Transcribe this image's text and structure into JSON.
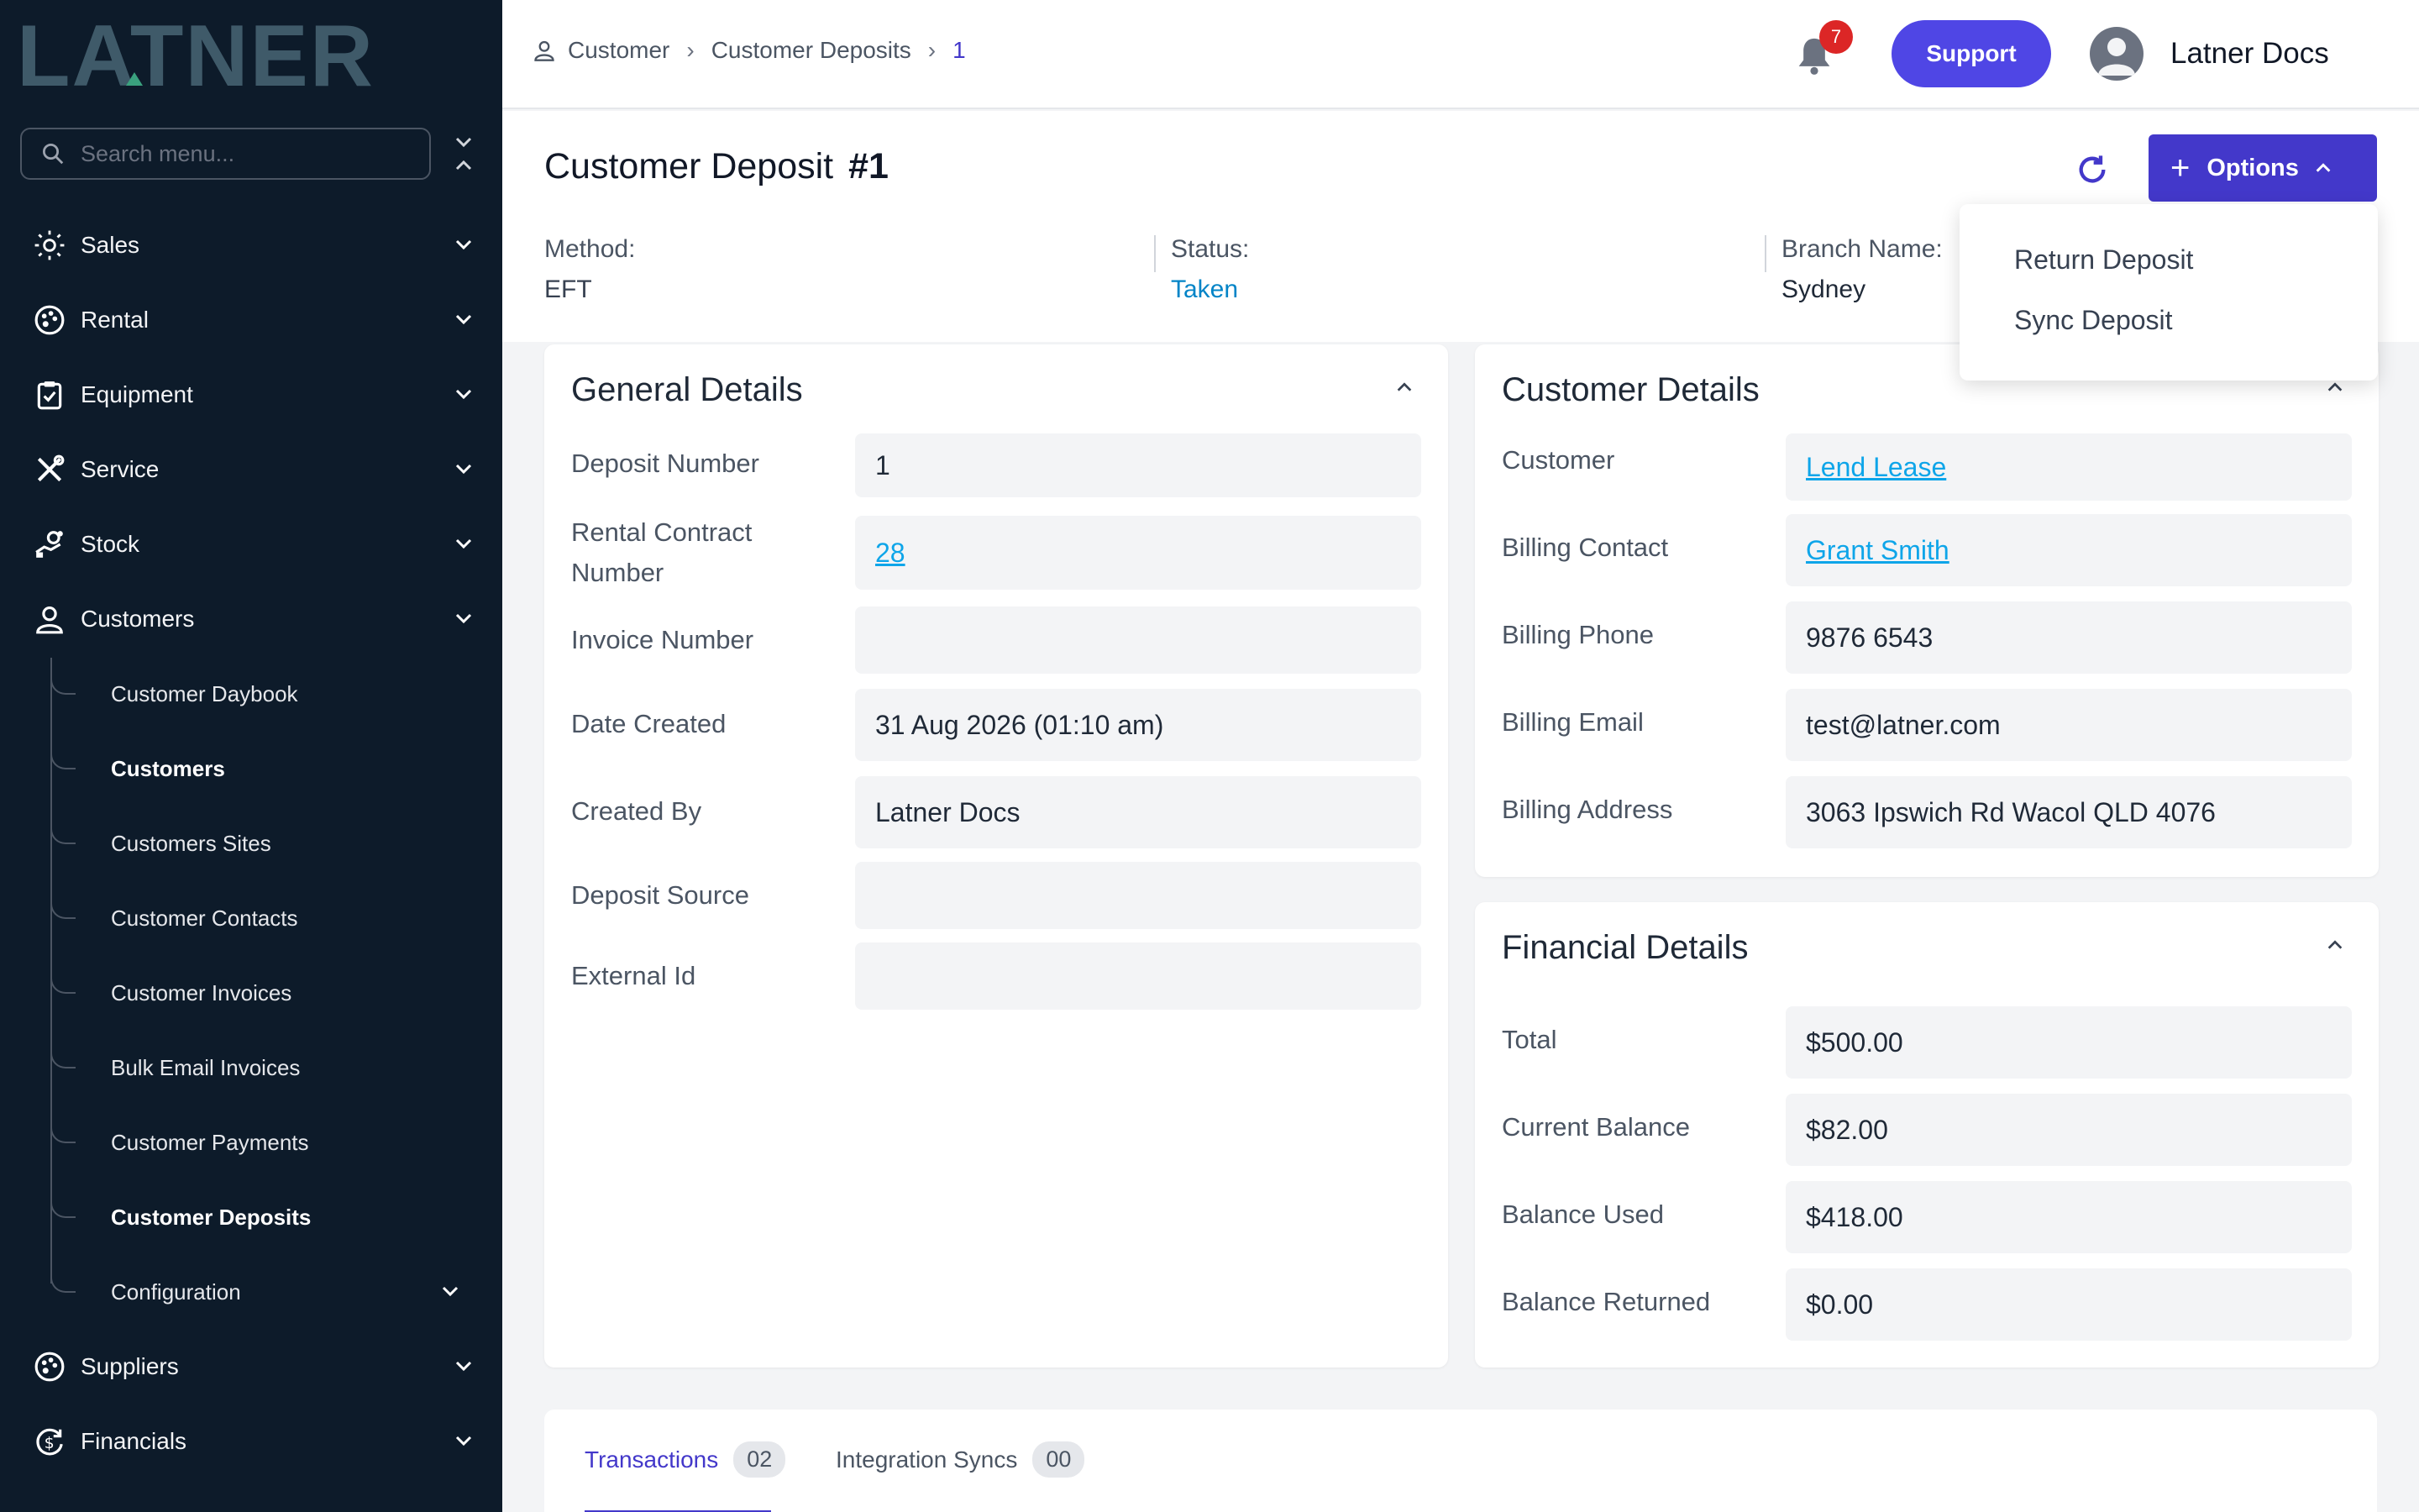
{
  "brand": {
    "logo_text": "LATNER"
  },
  "sidebar": {
    "search_placeholder": "Search menu...",
    "items": [
      {
        "label": "Sales",
        "icon": "sun-icon"
      },
      {
        "label": "Rental",
        "icon": "palette-icon"
      },
      {
        "label": "Equipment",
        "icon": "clipboard-icon"
      },
      {
        "label": "Service",
        "icon": "tools-icon"
      },
      {
        "label": "Stock",
        "icon": "hand-coins-icon"
      },
      {
        "label": "Customers",
        "icon": "user-icon"
      }
    ],
    "sub_items": [
      {
        "label": "Customer Daybook"
      },
      {
        "label": "Customers"
      },
      {
        "label": "Customers Sites"
      },
      {
        "label": "Customer Contacts"
      },
      {
        "label": "Customer Invoices"
      },
      {
        "label": "Bulk Email Invoices"
      },
      {
        "label": "Customer Payments"
      },
      {
        "label": "Customer Deposits"
      },
      {
        "label": "Configuration"
      }
    ],
    "bottom_items": [
      {
        "label": "Suppliers",
        "icon": "palette-icon"
      },
      {
        "label": "Financials",
        "icon": "dollar-cycle-icon"
      }
    ]
  },
  "header": {
    "breadcrumb": [
      "Customer",
      "Customer Deposits",
      "1"
    ],
    "notification_count": "7",
    "support_label": "Support",
    "user_name": "Latner Docs"
  },
  "page": {
    "title": "Customer Deposit",
    "number": "#1",
    "options_label": "Options",
    "meta": [
      {
        "label": "Method:",
        "value": "EFT"
      },
      {
        "label": "Status:",
        "value": "Taken"
      },
      {
        "label": "Branch Name:",
        "value": "Sydney"
      }
    ],
    "options_menu": [
      "Return Deposit",
      "Sync Deposit"
    ]
  },
  "general_details": {
    "title": "General Details",
    "rows": [
      {
        "label": "Deposit Number",
        "value": "1"
      },
      {
        "label": "Rental Contract Number",
        "value": "28"
      },
      {
        "label": "Invoice Number",
        "value": ""
      },
      {
        "label": "Date Created",
        "value": "31 Aug 2026 (01:10 am)"
      },
      {
        "label": "Created By",
        "value": "Latner Docs"
      },
      {
        "label": "Deposit Source",
        "value": ""
      },
      {
        "label": "External Id",
        "value": ""
      }
    ]
  },
  "customer_details": {
    "title": "Customer Details",
    "rows": [
      {
        "label": "Customer",
        "value": "Lend Lease"
      },
      {
        "label": "Billing Contact",
        "value": "Grant Smith"
      },
      {
        "label": "Billing Phone",
        "value": "9876 6543"
      },
      {
        "label": "Billing Email",
        "value": "test@latner.com"
      },
      {
        "label": "Billing Address",
        "value": "3063 Ipswich Rd Wacol QLD 4076"
      }
    ]
  },
  "financial_details": {
    "title": "Financial Details",
    "rows": [
      {
        "label": "Total",
        "value": "$500.00"
      },
      {
        "label": "Current Balance",
        "value": "$82.00"
      },
      {
        "label": "Balance Used",
        "value": "$418.00"
      },
      {
        "label": "Balance Returned",
        "value": "$0.00"
      }
    ]
  },
  "tabs": [
    {
      "label": "Transactions",
      "count": "02"
    },
    {
      "label": "Integration Syncs",
      "count": "00"
    }
  ],
  "colors": {
    "sidebar_bg": "#0d1b2a",
    "accent": "#4338ca",
    "link": "#0ea5e9",
    "logo": "#3f5a69",
    "logo_triangle": "#3aa17e"
  }
}
